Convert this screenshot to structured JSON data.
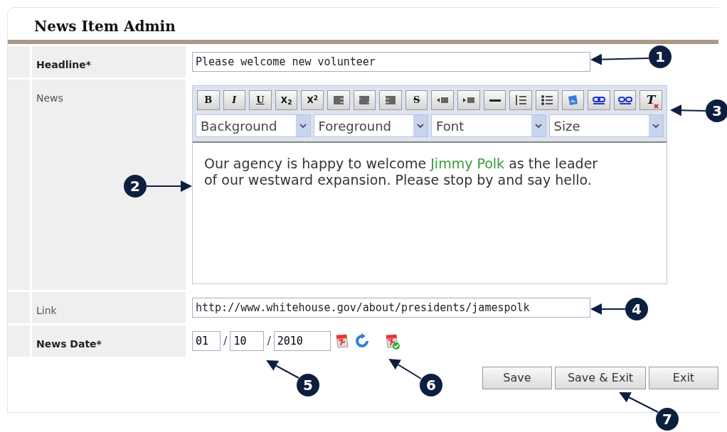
{
  "panel": {
    "title": "News Item Admin"
  },
  "required_mark": "*",
  "fields": [
    {
      "kind": "text",
      "label": "Headline",
      "required": true,
      "value": "Please welcome new volunteer"
    },
    {
      "kind": "editor",
      "label": "News",
      "required": false
    },
    {
      "kind": "text",
      "label": "Link",
      "required": false,
      "value": "http://www.whitehouse.gov/about/presidents/jamespolk"
    },
    {
      "kind": "date",
      "label": "News Date",
      "required": true,
      "day": "01",
      "month": "10",
      "year": "2010",
      "separator": "/"
    }
  ],
  "editor": {
    "toolbar": [
      {
        "kind": "bold",
        "label": "B"
      },
      {
        "kind": "italic",
        "label": "I"
      },
      {
        "kind": "underline",
        "label": "U"
      },
      {
        "kind": "subscript",
        "label": "X$_{2}$"
      },
      {
        "kind": "superscript",
        "label": "X$^{2}$"
      },
      {
        "kind": "align-left"
      },
      {
        "kind": "align-center"
      },
      {
        "kind": "align-right"
      },
      {
        "kind": "strike",
        "label": "S"
      },
      {
        "kind": "indent"
      },
      {
        "kind": "outdent"
      },
      {
        "kind": "rule"
      },
      {
        "kind": "ordered-list"
      },
      {
        "kind": "bullet-list"
      },
      {
        "kind": "image"
      },
      {
        "kind": "link"
      },
      {
        "kind": "unlink"
      },
      {
        "kind": "clear-format",
        "label": "T"
      }
    ],
    "dropdowns": [
      "Background",
      "Foreground",
      "Font",
      "Size"
    ],
    "body": [
      {
        "kind": "plain",
        "text": "Our agency is happy to welcome "
      },
      {
        "kind": "highlight",
        "text": "Jimmy Polk"
      },
      {
        "kind": "plain",
        "text": " as the leader of our westward expansion. Please stop by and say hello."
      }
    ]
  },
  "buttons": [
    "Save",
    "Save & Exit",
    "Exit"
  ],
  "callouts": [
    "1",
    "2",
    "3",
    "4",
    "5",
    "6",
    "7"
  ]
}
